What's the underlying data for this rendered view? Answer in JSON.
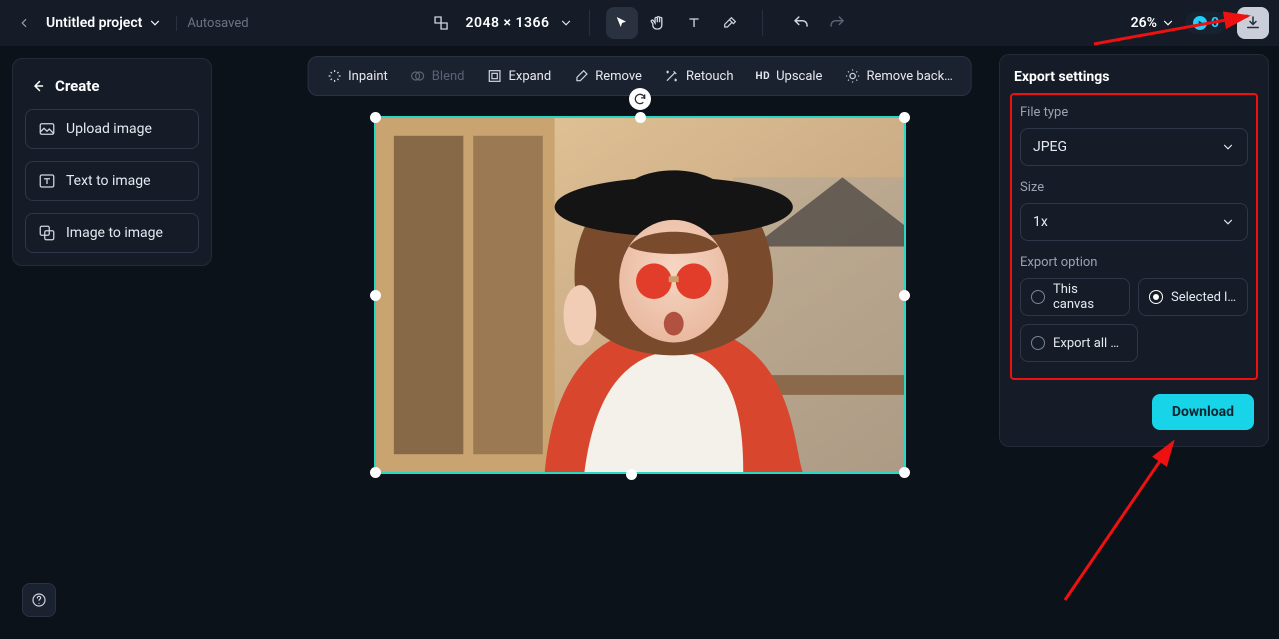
{
  "header": {
    "project_title": "Untitled project",
    "autosaved_label": "Autosaved",
    "dimensions": "2048 × 1366",
    "zoom": "26%",
    "credits": "0"
  },
  "sidebar": {
    "create_label": "Create",
    "items": [
      {
        "label": "Upload image"
      },
      {
        "label": "Text to image"
      },
      {
        "label": "Image to image"
      }
    ]
  },
  "action_bar": {
    "items": [
      {
        "label": "Inpaint"
      },
      {
        "label": "Blend"
      },
      {
        "label": "Expand"
      },
      {
        "label": "Remove"
      },
      {
        "label": "Retouch"
      },
      {
        "hd": "HD",
        "label": "Upscale"
      },
      {
        "label": "Remove back…"
      }
    ]
  },
  "export": {
    "title": "Export settings",
    "file_type_label": "File type",
    "file_type_value": "JPEG",
    "size_label": "Size",
    "size_value": "1x",
    "option_label": "Export option",
    "options": {
      "this_canvas": "This canvas",
      "selected": "Selected l…",
      "export_all": "Export all …"
    },
    "download_label": "Download"
  }
}
